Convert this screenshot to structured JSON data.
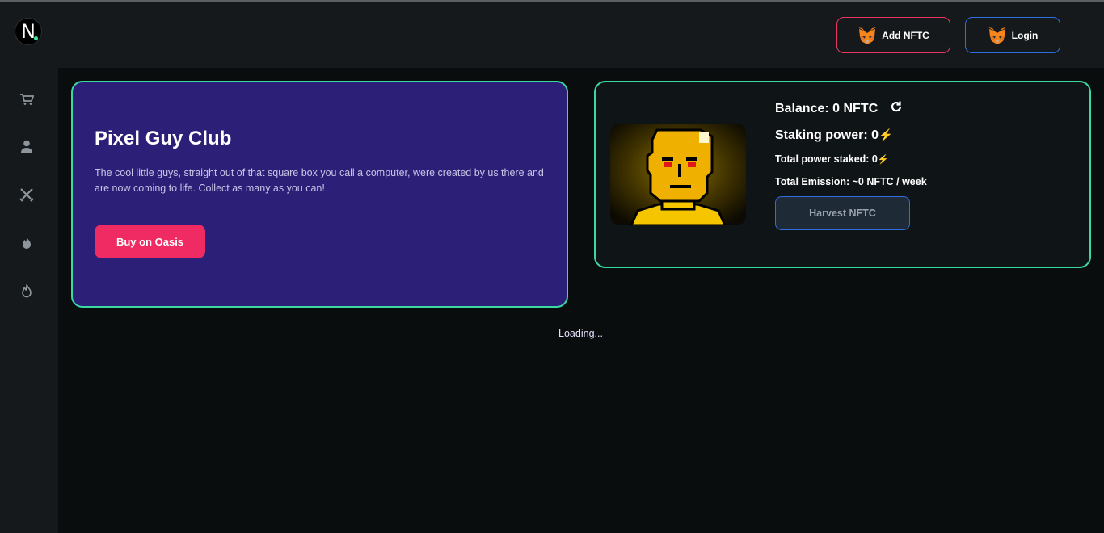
{
  "header": {
    "add_nftc_label": "Add NFTC",
    "login_label": "Login",
    "logo_letter": "N"
  },
  "sidebar": {
    "items": [
      {
        "icon": "cart-icon"
      },
      {
        "icon": "user-icon"
      },
      {
        "icon": "crossed-swords-icon"
      },
      {
        "icon": "flame-icon"
      },
      {
        "icon": "flame-outline-icon"
      }
    ]
  },
  "club": {
    "title": "Pixel Guy Club",
    "description": "The cool little guys, straight out of that square box you call a computer, were created by us there and are now coming to life. Collect as many as you can!",
    "buy_label": "Buy on Oasis"
  },
  "staking": {
    "balance": "Balance: 0 NFTC",
    "staking_power": "Staking power: 0",
    "total_power_staked": "Total power staked: 0",
    "total_emission": "Total Emission: ~0 NFTC / week",
    "harvest_label": "Harvest NFTC",
    "bolt": "⚡"
  },
  "status": {
    "loading": "Loading..."
  },
  "colors": {
    "accent_green": "#3ad9a2",
    "card_purple": "#2c1f78",
    "buy_pink": "#f02b63",
    "add_border": "#e8365f",
    "login_border": "#2d6ee0"
  }
}
